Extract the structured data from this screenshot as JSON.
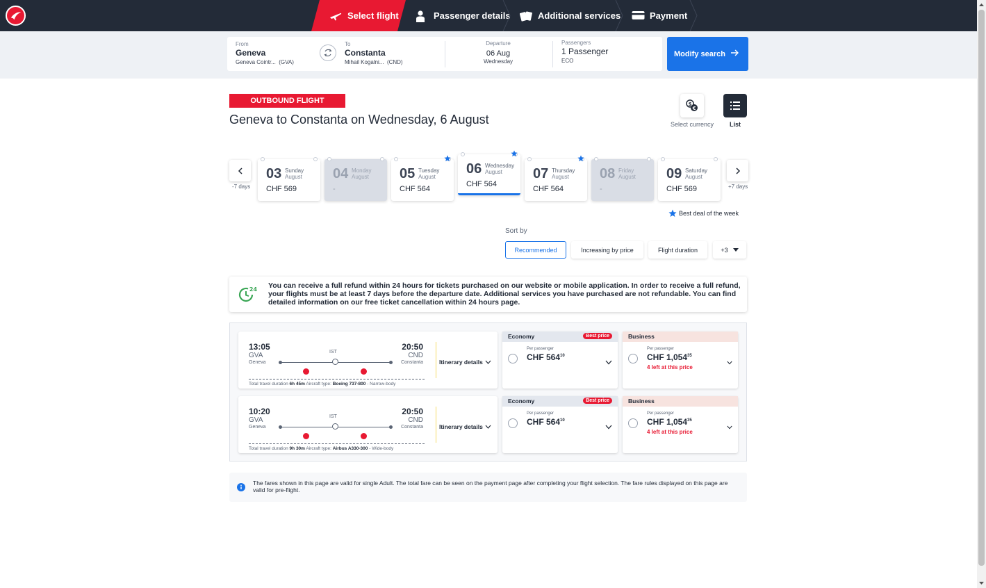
{
  "nav": {
    "steps": [
      {
        "label": "Select flight",
        "icon": "plane-icon",
        "active": true
      },
      {
        "label": "Passenger details",
        "icon": "person-icon",
        "active": false
      },
      {
        "label": "Additional services",
        "icon": "tickets-icon",
        "active": false
      },
      {
        "label": "Payment",
        "icon": "credit-card-icon",
        "active": false
      }
    ],
    "brand_color": "#e81932"
  },
  "search": {
    "from_label": "From",
    "from_city": "Geneva",
    "from_airport": "Geneva Cointr...",
    "from_code": "(GVA)",
    "to_label": "To",
    "to_city": "Constanta",
    "to_airport": "Mihail Kogalni...",
    "to_code": "(CND)",
    "departure_label": "Departure",
    "departure_date": "06 Aug",
    "departure_day": "Wednesday",
    "passengers_label": "Passengers",
    "passengers_value": "1 Passenger",
    "cabin": "ECO",
    "modify_label": "Modify search"
  },
  "header": {
    "badge": "OUTBOUND FLIGHT",
    "title": "Geneva to Constanta on Wednesday, 6 August",
    "currency_label": "Select currency",
    "list_label": "List"
  },
  "dates": {
    "prev_label": "-7 days",
    "next_label": "+7 days",
    "best_deal_label": "Best deal of the week",
    "days": [
      {
        "num": "03",
        "name": "Sunday",
        "month": "August",
        "price": "CHF 569",
        "disabled": false,
        "selected": false,
        "best": false
      },
      {
        "num": "04",
        "name": "Monday",
        "month": "August",
        "price": "-",
        "disabled": true,
        "selected": false,
        "best": false
      },
      {
        "num": "05",
        "name": "Tuesday",
        "month": "August",
        "price": "CHF 564",
        "disabled": false,
        "selected": false,
        "best": true
      },
      {
        "num": "06",
        "name": "Wednesday",
        "month": "August",
        "price": "CHF 564",
        "disabled": false,
        "selected": true,
        "best": true
      },
      {
        "num": "07",
        "name": "Thursday",
        "month": "August",
        "price": "CHF 564",
        "disabled": false,
        "selected": false,
        "best": true
      },
      {
        "num": "08",
        "name": "Friday",
        "month": "August",
        "price": "-",
        "disabled": true,
        "selected": false,
        "best": false
      },
      {
        "num": "09",
        "name": "Saturday",
        "month": "August",
        "price": "CHF 569",
        "disabled": false,
        "selected": false,
        "best": false
      }
    ]
  },
  "sort": {
    "label": "Sort by",
    "options": [
      "Recommended",
      "Increasing by price",
      "Flight duration",
      "+3"
    ]
  },
  "refund": {
    "text": "You can receive a full refund within 24 hours for tickets purchased on our website or mobile application. In order to receive a full refund, your flights must be at least 7 days before the departure date. Additional services you have purchased are not refundable. You can find detailed information on our free ticket cancellation within 24 hours page.",
    "icon_text": "24"
  },
  "flights": [
    {
      "dep_time": "13:05",
      "dep_code": "GVA",
      "dep_city": "Geneva",
      "arr_time": "20:50",
      "arr_code": "CND",
      "arr_city": "Constanta",
      "stop": "IST",
      "duration_label": "Total travel duration",
      "duration": "6h 45m",
      "aircraft_label": "Aircraft type:",
      "aircraft": "Boeing 737-800",
      "body": "Narrow-body",
      "itinerary_label": "Itinerary details",
      "economy": {
        "label": "Economy",
        "badge": "Best price",
        "per": "Per passenger",
        "price": "CHF 564",
        "cents": "10"
      },
      "business": {
        "label": "Business",
        "per": "Per passenger",
        "price": "CHF 1,054",
        "cents": "35",
        "left": "4 left at this price"
      }
    },
    {
      "dep_time": "10:20",
      "dep_code": "GVA",
      "dep_city": "Geneva",
      "arr_time": "20:50",
      "arr_code": "CND",
      "arr_city": "Constanta",
      "stop": "IST",
      "duration_label": "Total travel duration",
      "duration": "9h 30m",
      "aircraft_label": "Aircraft type:",
      "aircraft": "Airbus A330-300",
      "body": "Wide-body",
      "itinerary_label": "Itinerary details",
      "economy": {
        "label": "Economy",
        "badge": "Best price",
        "per": "Per passenger",
        "price": "CHF 564",
        "cents": "10"
      },
      "business": {
        "label": "Business",
        "per": "Per passenger",
        "price": "CHF 1,054",
        "cents": "35",
        "left": "4 left at this price"
      }
    }
  ],
  "info": {
    "text": "The fares shown in this page are valid for single Adult. The total fare can be seen on the payment page after completing your flight selection. The fare rules displayed on this page are valid for pre-flight."
  }
}
